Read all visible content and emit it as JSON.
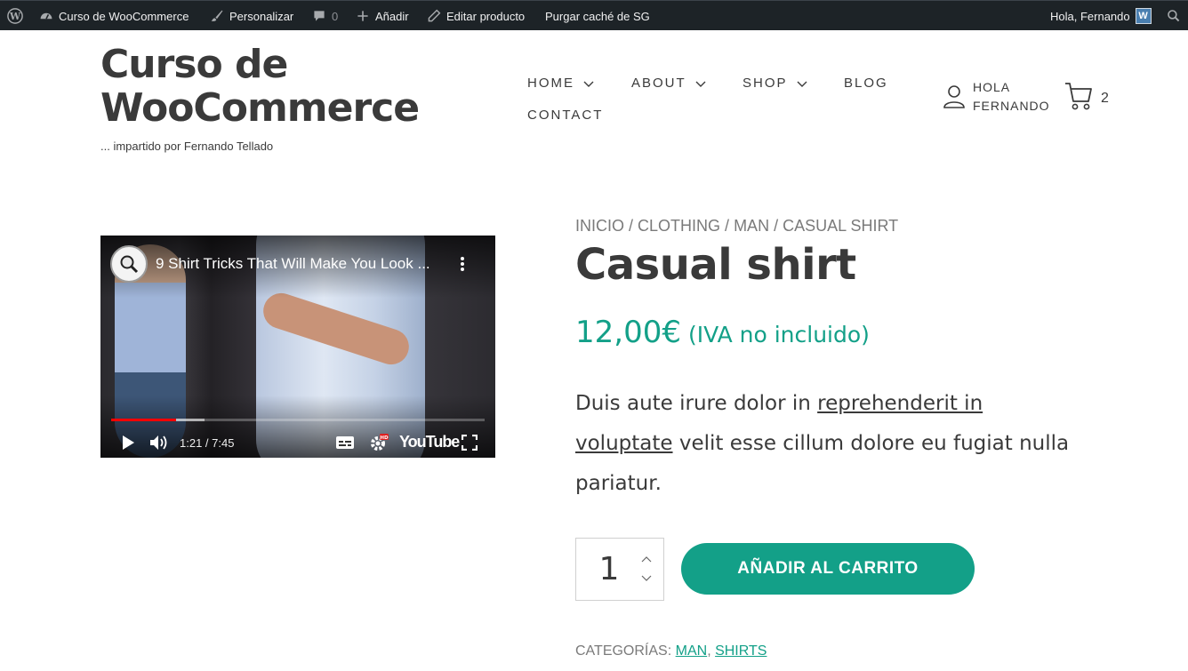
{
  "colors": {
    "adminbar_bg": "#1d2327",
    "accent": "#13a088",
    "text": "#3a3a3a",
    "muted": "#7a7a7a"
  },
  "adminbar": {
    "site_name": "Curso de WooCommerce",
    "customize": "Personalizar",
    "comments_count": "0",
    "new_label": "Añadir",
    "edit_product": "Editar producto",
    "purge_cache": "Purgar caché de SG",
    "greeting": "Hola, Fernando",
    "icons": [
      "wordpress-icon",
      "dashboard-icon",
      "brush-icon",
      "comment-icon",
      "plus-icon",
      "pencil-icon",
      "avatar",
      "search-icon"
    ]
  },
  "header": {
    "site_title": "Curso de WooCommerce",
    "tagline": "... impartido por Fernando Tellado",
    "nav": [
      "HOME",
      "ABOUT",
      "SHOP",
      "BLOG",
      "CONTACT"
    ],
    "account_line1": "HOLA",
    "account_line2": "FERNANDO",
    "cart_count": "2"
  },
  "video": {
    "title": "9 Shirt Tricks That Will Make You Look ...",
    "time": "1:21 / 7:45",
    "brand": "YouTube",
    "progress": 0.174,
    "buffered": 0.25
  },
  "product": {
    "breadcrumb": [
      "INICIO",
      "CLOTHING",
      "MAN",
      "CASUAL SHIRT"
    ],
    "breadcrumb_sep": " / ",
    "title": "Casual shirt",
    "price": "12,00€",
    "price_suffix": "(IVA no incluido)",
    "desc_before": "Duis aute irure dolor in ",
    "desc_link": "reprehenderit in voluptate",
    "desc_after": " velit esse cillum dolore eu fugiat nulla pariatur.",
    "quantity": "1",
    "add_to_cart": "AÑADIR AL CARRITO",
    "categories_label": "CATEGORÍAS:",
    "categories": [
      "MAN",
      "SHIRTS"
    ],
    "categories_sep": ", "
  }
}
